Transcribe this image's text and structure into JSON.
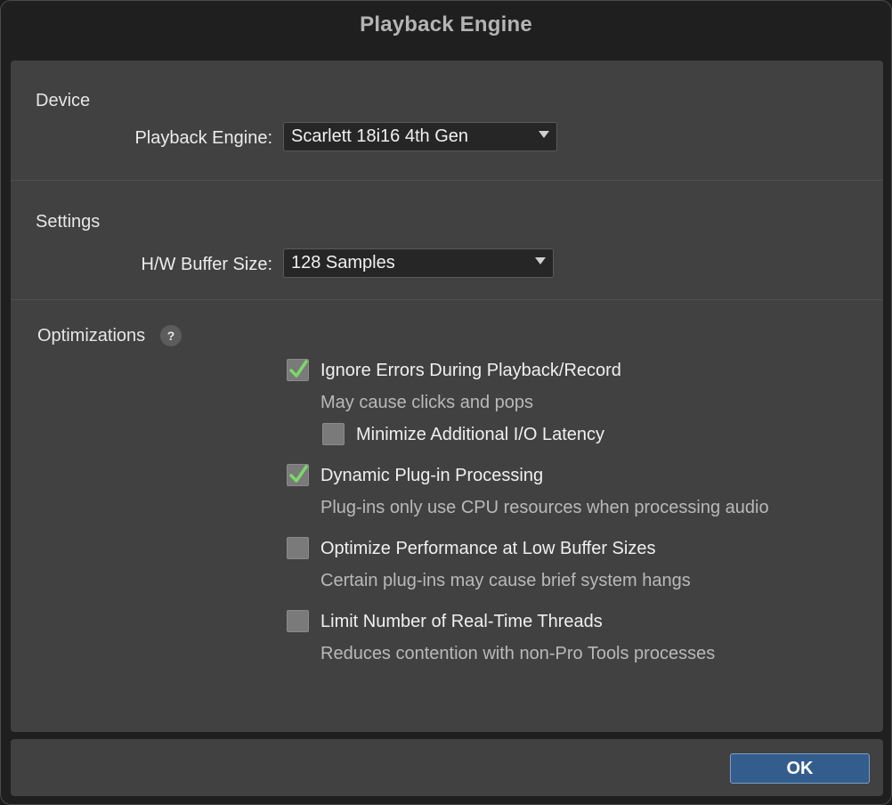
{
  "window": {
    "title": "Playback Engine"
  },
  "device": {
    "section_label": "Device",
    "engine_label": "Playback Engine:",
    "engine_value": "Scarlett 18i16 4th Gen"
  },
  "settings": {
    "section_label": "Settings",
    "buffer_label": "H/W Buffer Size:",
    "buffer_value": "128 Samples"
  },
  "optimizations": {
    "section_label": "Optimizations",
    "help_glyph": "?",
    "items": [
      {
        "label": "Ignore Errors During Playback/Record",
        "description": "May cause clicks and pops",
        "checked": true
      },
      {
        "label": "Minimize Additional I/O Latency",
        "checked": false
      },
      {
        "label": "Dynamic Plug-in Processing",
        "description": "Plug-ins only use CPU resources when processing audio",
        "checked": true
      },
      {
        "label": "Optimize Performance at Low Buffer Sizes",
        "description": "Certain plug-ins may cause brief system hangs",
        "checked": false
      },
      {
        "label": "Limit Number of Real-Time Threads",
        "description": "Reduces contention with non-Pro Tools processes",
        "checked": false
      }
    ]
  },
  "footer": {
    "ok_label": "OK"
  },
  "colors": {
    "accent": "#335d8d",
    "check": "#7bd86a",
    "panel": "#414141",
    "background": "#1f1f1f"
  },
  "icons": {
    "check": "checkmark-icon",
    "caret": "chevron-down-icon",
    "help": "help-icon"
  }
}
